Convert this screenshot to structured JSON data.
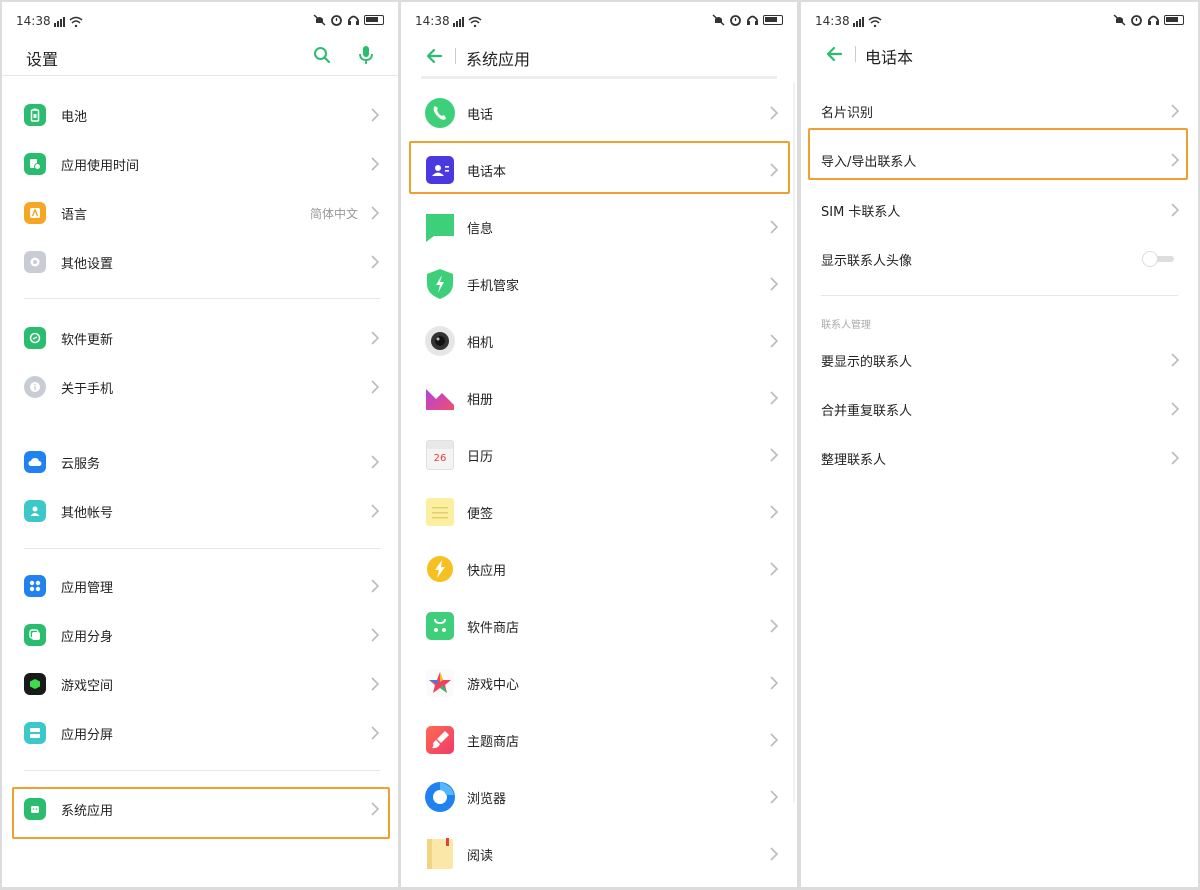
{
  "status": {
    "time": "14:38"
  },
  "panel1": {
    "title": "设置",
    "items": [
      {
        "label": "电池"
      },
      {
        "label": "应用使用时间"
      },
      {
        "label": "语言",
        "value": "简体中文"
      },
      {
        "label": "其他设置"
      },
      {
        "label": "软件更新"
      },
      {
        "label": "关于手机"
      },
      {
        "label": "云服务"
      },
      {
        "label": "其他帐号"
      },
      {
        "label": "应用管理"
      },
      {
        "label": "应用分身"
      },
      {
        "label": "游戏空间"
      },
      {
        "label": "应用分屏"
      },
      {
        "label": "系统应用"
      }
    ]
  },
  "panel2": {
    "title": "系统应用",
    "items": [
      {
        "label": "电话"
      },
      {
        "label": "电话本"
      },
      {
        "label": "信息"
      },
      {
        "label": "手机管家"
      },
      {
        "label": "相机"
      },
      {
        "label": "相册"
      },
      {
        "label": "日历",
        "icon_text": "26"
      },
      {
        "label": "便签"
      },
      {
        "label": "快应用"
      },
      {
        "label": "软件商店"
      },
      {
        "label": "游戏中心"
      },
      {
        "label": "主题商店"
      },
      {
        "label": "浏览器"
      },
      {
        "label": "阅读"
      }
    ]
  },
  "panel3": {
    "title": "电话本",
    "items": [
      {
        "label": "名片识别"
      },
      {
        "label": "导入/导出联系人"
      },
      {
        "label": "SIM 卡联系人"
      },
      {
        "label": "显示联系人头像"
      }
    ],
    "section_label": "联系人管理",
    "items2": [
      {
        "label": "要显示的联系人"
      },
      {
        "label": "合并重复联系人"
      },
      {
        "label": "整理联系人"
      }
    ]
  },
  "colors": {
    "accent": "#2bbd6e",
    "highlight": "#f0a030"
  }
}
